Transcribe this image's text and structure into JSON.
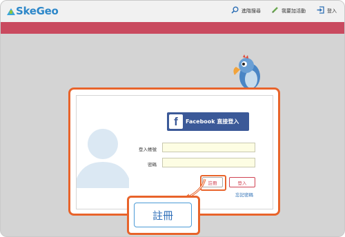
{
  "header": {
    "logo_text": "SkeGeo",
    "nav": [
      {
        "label": "進階搜尋",
        "icon": "search-icon"
      },
      {
        "label": "我要加活動",
        "icon": "pencil-icon"
      },
      {
        "label": "登入",
        "icon": "login-icon"
      }
    ]
  },
  "login_modal": {
    "facebook_label": "Facebook 直接登入",
    "account_label": "登入帳號",
    "password_label": "密碼",
    "account_value": "",
    "password_value": "",
    "register_label": "註冊",
    "login_label": "登入",
    "forgot_label": "忘記密碼"
  },
  "callout": {
    "register_zoom_label": "註冊"
  },
  "colors": {
    "accent_orange": "#e8632a",
    "header_red": "#c94a5f",
    "facebook_blue": "#3b5998",
    "link_blue": "#2d6fb5"
  }
}
